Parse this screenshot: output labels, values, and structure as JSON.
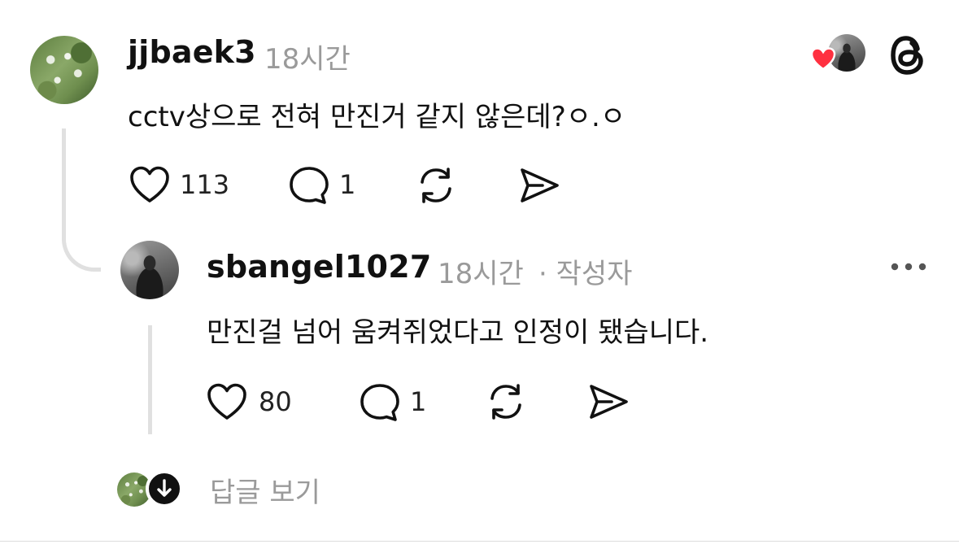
{
  "post": {
    "username": "jjbaek3",
    "time": "18시간",
    "text": "cctv상으로 전혀 만진거 같지 않은데?ㅇ.ㅇ",
    "likes": "113",
    "replies": "1"
  },
  "reply": {
    "username": "sbangel1027",
    "time": "18시간",
    "author_tag": "· 작성자",
    "text": "만진걸 넘어 움켜쥐었다고 인정이 됐습니다.",
    "likes": "80",
    "replies": "1"
  },
  "view_replies_label": "답글 보기",
  "colors": {
    "heart_red": "#ff3040",
    "muted_text": "#9a9a9a",
    "thread_line": "#e0e0e0"
  },
  "icons": [
    "heart-icon",
    "comment-icon",
    "repost-icon",
    "share-icon",
    "threads-logo-icon",
    "more-icon",
    "arrow-down-icon"
  ]
}
